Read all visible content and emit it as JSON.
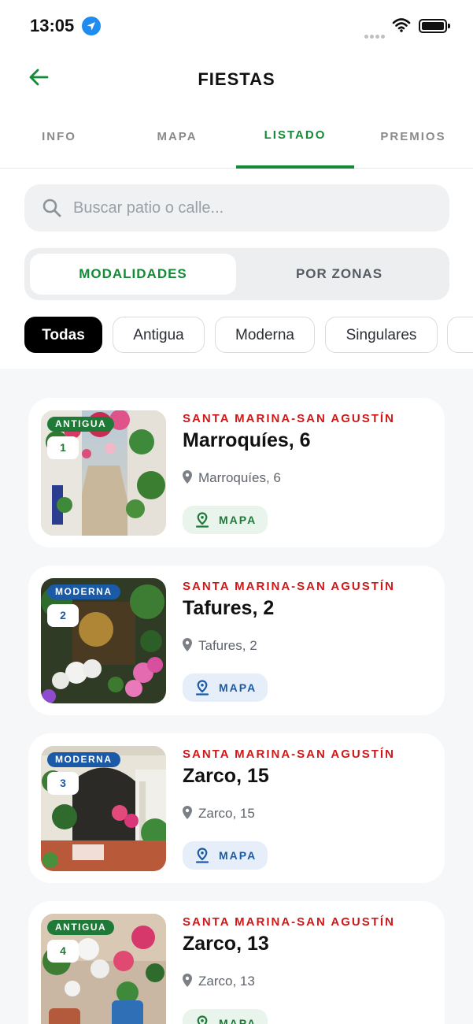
{
  "status_bar": {
    "time": "13:05"
  },
  "header": {
    "title": "FIESTAS"
  },
  "tabs": [
    {
      "label": "INFO",
      "active": false
    },
    {
      "label": "MAPA",
      "active": false
    },
    {
      "label": "LISTADO",
      "active": true
    },
    {
      "label": "PREMIOS",
      "active": false
    }
  ],
  "search": {
    "placeholder": "Buscar patio o calle..."
  },
  "segments": [
    {
      "label": "MODALIDADES",
      "active": true
    },
    {
      "label": "POR ZONAS",
      "active": false
    }
  ],
  "chips": [
    {
      "label": "Todas",
      "active": true
    },
    {
      "label": "Antigua",
      "active": false
    },
    {
      "label": "Moderna",
      "active": false
    },
    {
      "label": "Singulares",
      "active": false
    }
  ],
  "colors": {
    "accent_green": "#138a36",
    "zone_red": "#d01818",
    "badge_green": "#1e7a36",
    "badge_blue": "#1b5aa6"
  },
  "patios": [
    {
      "category": "ANTIGUA",
      "number": "1",
      "zone": "SANTA MARINA-SAN AGUSTÍN",
      "name": "Marroquíes, 6",
      "address": "Marroquíes, 6",
      "map_label": "MAPA"
    },
    {
      "category": "MODERNA",
      "number": "2",
      "zone": "SANTA MARINA-SAN AGUSTÍN",
      "name": "Tafures, 2",
      "address": "Tafures, 2",
      "map_label": "MAPA"
    },
    {
      "category": "MODERNA",
      "number": "3",
      "zone": "SANTA MARINA-SAN AGUSTÍN",
      "name": "Zarco, 15",
      "address": "Zarco, 15",
      "map_label": "MAPA"
    },
    {
      "category": "ANTIGUA",
      "number": "4",
      "zone": "SANTA MARINA-SAN AGUSTÍN",
      "name": "Zarco, 13",
      "address": "Zarco, 13",
      "map_label": "MAPA"
    }
  ]
}
